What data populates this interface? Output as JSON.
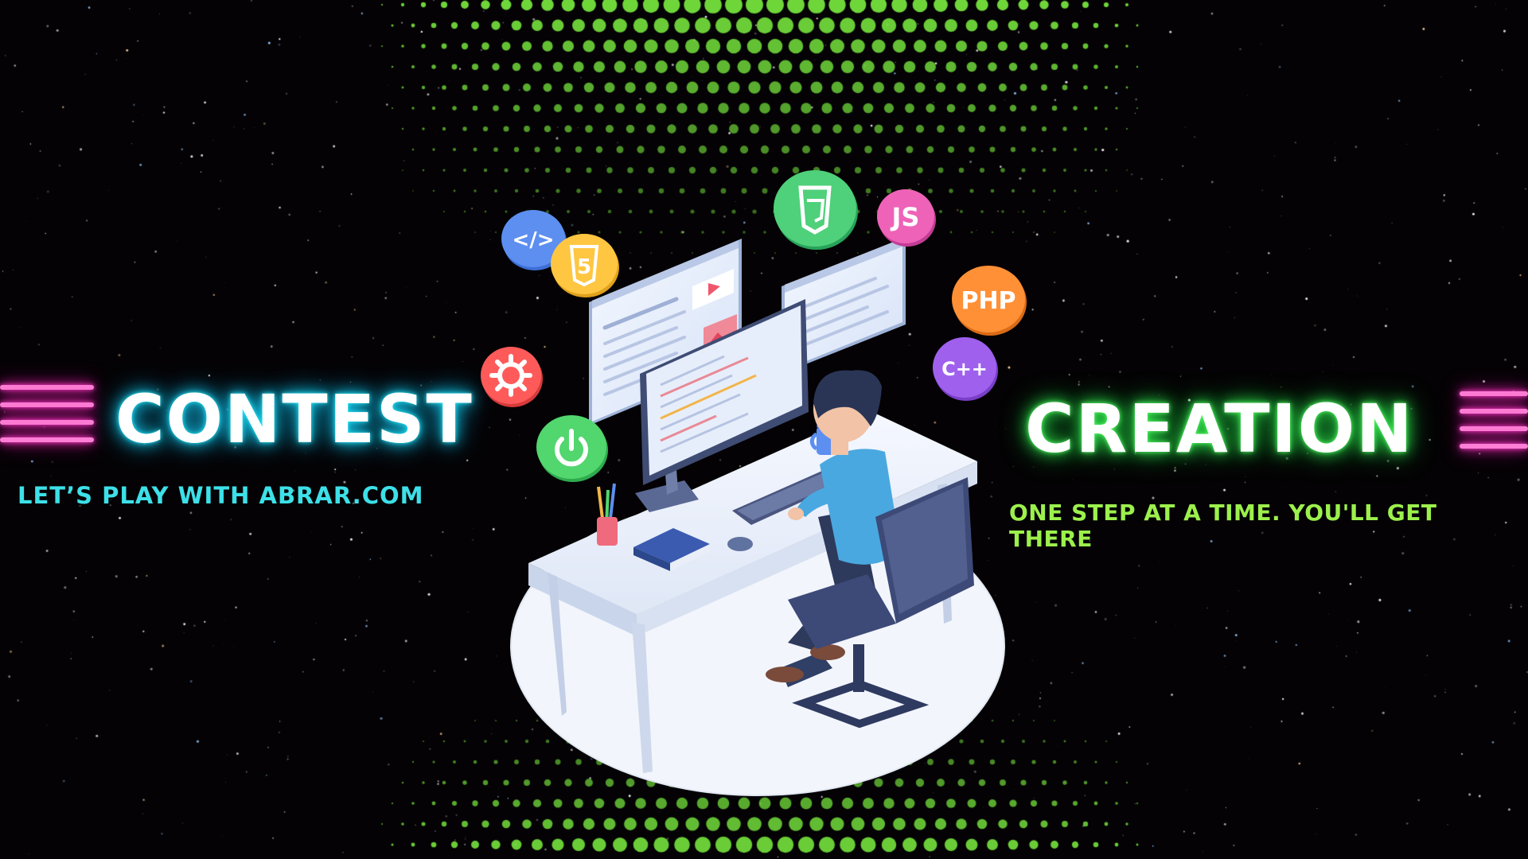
{
  "headline_left": "CONTEST",
  "headline_right": "CREATION",
  "tagline_left": "LET’S PLAY WITH ABRAR.COM",
  "tagline_right": "ONE STEP AT A TIME. YOU'LL GET THERE",
  "badges": {
    "js": "JS",
    "php": "PHP",
    "cpp": "C++",
    "code": "</>",
    "html5": "5"
  },
  "colors": {
    "background": "#040204",
    "neon_pink": "#ff2bbd",
    "neon_cyan": "#16c8e8",
    "neon_green": "#2fe04a",
    "dot_green": "#6fd63a"
  }
}
